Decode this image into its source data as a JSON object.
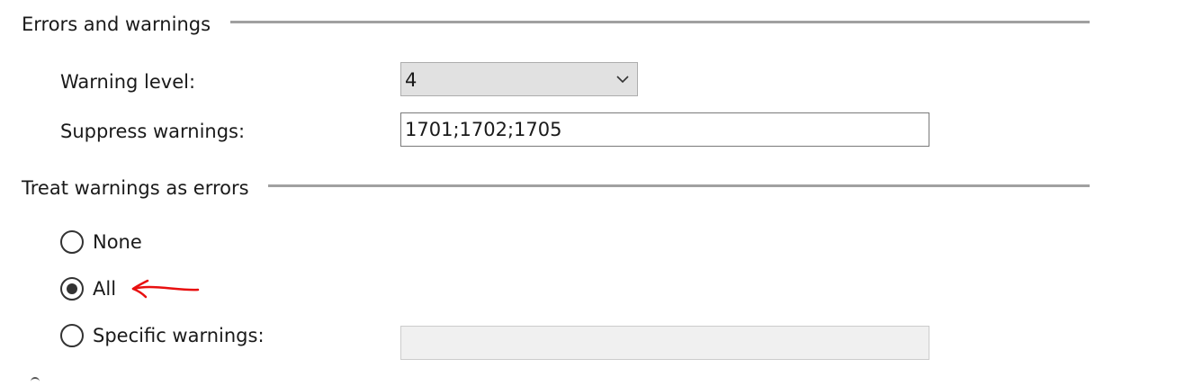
{
  "sections": {
    "errors": {
      "header": "Errors and warnings",
      "warning_level": {
        "label": "Warning level:",
        "value": "4"
      },
      "suppress_warnings": {
        "label": "Suppress warnings:",
        "value": "1701;1702;1705"
      }
    },
    "treat_as_errors": {
      "header": "Treat warnings as errors",
      "options": [
        {
          "label": "None",
          "selected": false
        },
        {
          "label": "All",
          "selected": true
        },
        {
          "label": "Specific warnings:",
          "selected": false
        }
      ],
      "specific_value": ""
    }
  },
  "icons": {
    "dropdown": "chevron-down-icon",
    "annotation": "red-arrow-left-icon"
  },
  "colors": {
    "annotation": "#e81010",
    "dropdown_bg": "#e1e1e1",
    "disabled_input_bg": "#f0f0f0",
    "rule": "#a0a0a0"
  }
}
